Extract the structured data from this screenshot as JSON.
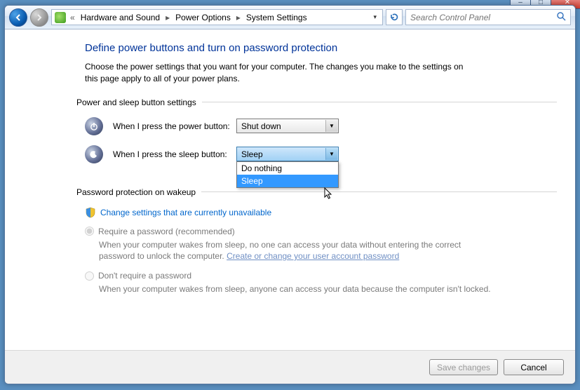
{
  "titlebar": {
    "min": "–",
    "max": "□",
    "close": "✕"
  },
  "breadcrumb": {
    "items": [
      "Hardware and Sound",
      "Power Options",
      "System Settings"
    ]
  },
  "search": {
    "placeholder": "Search Control Panel"
  },
  "page": {
    "heading": "Define power buttons and turn on password protection",
    "description": "Choose the power settings that you want for your computer. The changes you make to the settings on this page apply to all of your power plans."
  },
  "section_power": {
    "title": "Power and sleep button settings",
    "power_label": "When I press the power button:",
    "power_value": "Shut down",
    "sleep_label": "When I press the sleep button:",
    "sleep_value": "Sleep",
    "dropdown_options": [
      "Do nothing",
      "Sleep"
    ],
    "dropdown_highlight_index": 1
  },
  "section_password": {
    "title": "Password protection on wakeup",
    "change_link": "Change settings that are currently unavailable",
    "opt1_label": "Require a password (recommended)",
    "opt1_text_a": "When your computer wakes from sleep, no one can access your data without entering the correct password to unlock the computer. ",
    "opt1_link": "Create or change your user account password",
    "opt2_label": "Don't require a password",
    "opt2_text": "When your computer wakes from sleep, anyone can access your data because the computer isn't locked."
  },
  "footer": {
    "save": "Save changes",
    "cancel": "Cancel"
  }
}
